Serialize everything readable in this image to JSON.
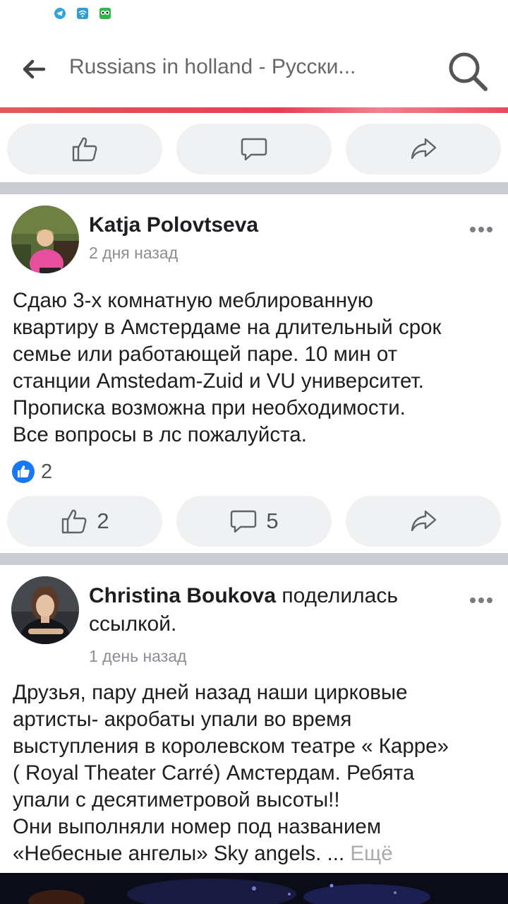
{
  "status_bar": {
    "icons": [
      "telegram-icon",
      "wifi-icon",
      "owl-app-icon"
    ]
  },
  "header": {
    "title": "Russians in holland - Русски...",
    "back_icon": "back-arrow-icon",
    "search_icon": "search-icon"
  },
  "top_actions": {
    "like_icon": "thumbs-up-icon",
    "comment_icon": "comment-icon",
    "share_icon": "share-icon"
  },
  "posts": [
    {
      "author": "Katja Polovtseva",
      "action": "",
      "time": "2 дня назад",
      "body": "Сдаю 3-х комнатную меблированную\nквартиру в Амстердаме на длительный срок\nсемье или работающей паре. 10 мин от\nстанции Amstedam-Zuid  и VU университет.\nПрописка возможна при необходимости.\nВсе вопросы в лс пожалуйста.",
      "reactions": "2",
      "likes": "2",
      "comments": "5"
    },
    {
      "author": "Christina Boukova",
      "action": " поделилась ссылкой.",
      "time": "1 день назад",
      "body": "Друзья, пару дней назад наши цирковые\nартисты- акробаты упали во время\nвыступления в королевском театре « Карре»\n( Royal Theater Carré) Амстердам. Ребята\nупали с десятиметровой высоты!!\nОни выполняли номер под названием\n«Небесные ангелы» Sky angels. ... ",
      "more": "Ещё"
    }
  ],
  "colors": {
    "accent_progress": "#e83e55",
    "like_blue": "#1877f2",
    "pill_bg": "#eff1f3",
    "separator": "#c9cdd1"
  }
}
